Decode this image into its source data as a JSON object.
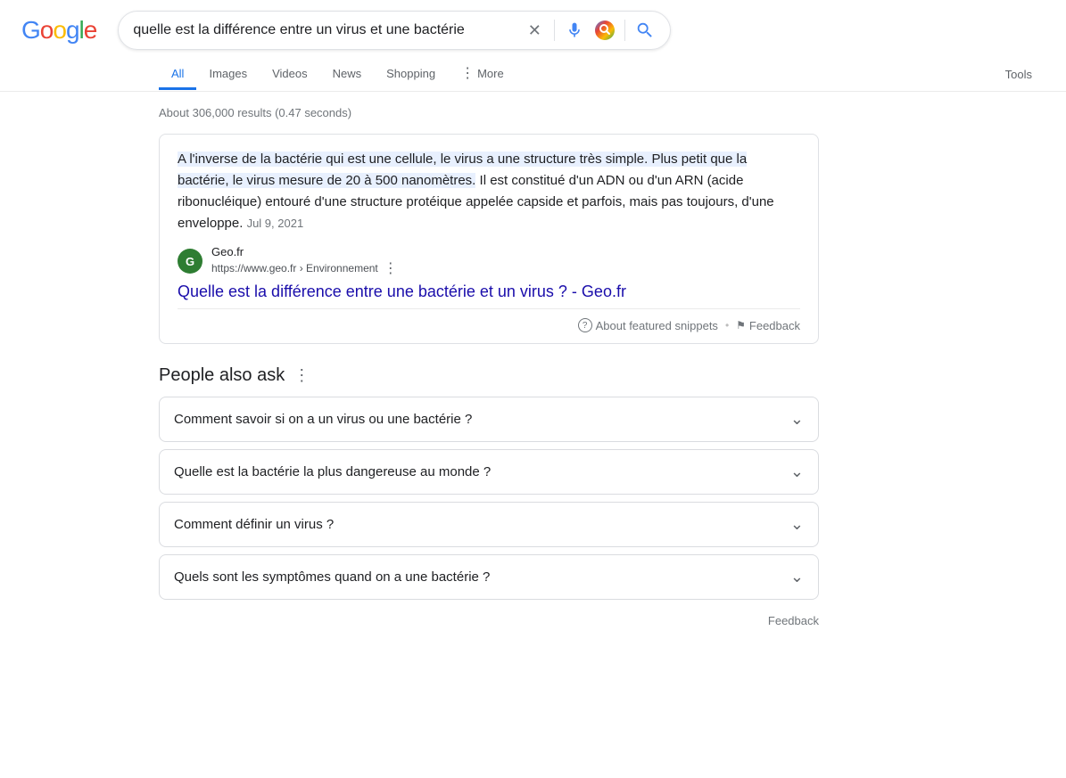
{
  "header": {
    "logo": "Google",
    "search_query": "quelle est la différence entre un virus et une bactérie"
  },
  "nav": {
    "items": [
      {
        "label": "All",
        "active": true
      },
      {
        "label": "Images",
        "active": false
      },
      {
        "label": "Videos",
        "active": false
      },
      {
        "label": "News",
        "active": false
      },
      {
        "label": "Shopping",
        "active": false
      },
      {
        "label": "More",
        "active": false
      }
    ],
    "tools_label": "Tools"
  },
  "results": {
    "count_text": "About 306,000 results (0.47 seconds)"
  },
  "featured_snippet": {
    "text_part1": "A l'inverse de la bactérie qui est une cellule, le virus a une structure très simple. Plus petit que la bactérie, le virus mesure de 20 à 500 nanomètres.",
    "text_part2": " Il est constitué d'un ADN ou d'un ARN (acide ribonucléique) entouré d'une structure protéique appelée capside et parfois, mais pas toujours, d'une enveloppe.",
    "date": "Jul 9, 2021",
    "source_initial": "G",
    "source_name": "Geo.fr",
    "source_url": "https://www.geo.fr › Environnement",
    "link_text": "Quelle est la différence entre une bactérie et un virus ? - Geo.fr",
    "about_snippets": "About featured snippets",
    "feedback": "Feedback"
  },
  "people_also_ask": {
    "title": "People also ask",
    "questions": [
      "Comment savoir si on a un virus ou une bactérie ?",
      "Quelle est la bactérie la plus dangereuse au monde ?",
      "Comment définir un virus ?",
      "Quels sont les symptômes quand on a une bactérie ?"
    ]
  },
  "footer": {
    "feedback": "Feedback"
  },
  "icons": {
    "close": "✕",
    "more_dots": "⋮",
    "chevron_down": "⌄",
    "question_circle": "?",
    "flag": "⚑",
    "search": "🔍"
  }
}
